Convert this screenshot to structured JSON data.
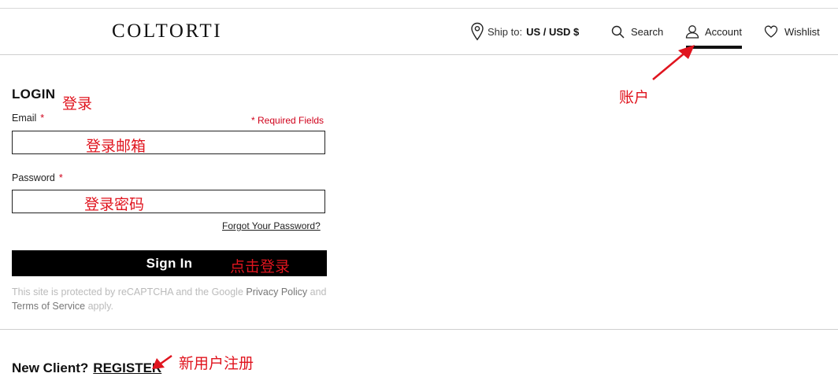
{
  "header": {
    "logo": "COLTORTI",
    "ship_label": "Ship to:",
    "ship_value": "US / USD $",
    "search_label": "Search",
    "account_label": "Account",
    "wishlist_label": "Wishlist",
    "icons": [
      "location-pin-icon",
      "search-icon",
      "user-icon",
      "heart-icon"
    ]
  },
  "login": {
    "title": "LOGIN",
    "email_label": "Email",
    "required_star": "*",
    "required_note": "* Required Fields",
    "email_value": "",
    "password_label": "Password",
    "password_value": "",
    "forgot_link": "Forgot Your Password?",
    "signin_label": "Sign In",
    "recaptcha_pre": "This site is protected by reCAPTCHA and the Google",
    "privacy_link": "Privacy Policy",
    "recaptcha_and": "and",
    "terms_link": "Terms of Service",
    "recaptcha_post": "apply."
  },
  "register": {
    "prompt": "New Client?",
    "link": "REGISTER"
  },
  "annotations": {
    "login": "登录",
    "email": "登录邮箱",
    "password": "登录密码",
    "signin": "点击登录",
    "account": "账户",
    "register": "新用户注册",
    "color": "#e0141e"
  }
}
